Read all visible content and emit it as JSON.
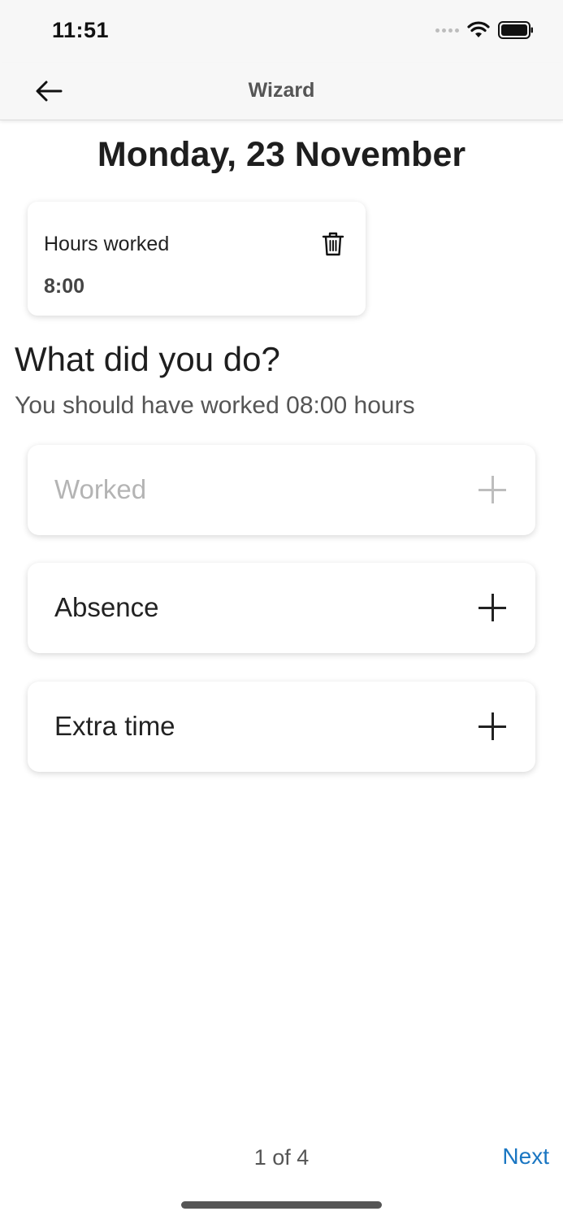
{
  "status_bar": {
    "time": "11:51"
  },
  "nav": {
    "title": "Wizard"
  },
  "date": "Monday, 23 November",
  "hours_card": {
    "label": "Hours worked",
    "value": "8:00"
  },
  "question": "What did you do?",
  "hint": "You should have worked 08:00 hours",
  "options": [
    {
      "label": "Worked",
      "enabled": false
    },
    {
      "label": "Absence",
      "enabled": true
    },
    {
      "label": "Extra time",
      "enabled": true
    }
  ],
  "footer": {
    "pager": "1 of 4",
    "next_label": "Next"
  },
  "colors": {
    "accent": "#1a76c2",
    "disabled": "#b4b4b4",
    "text": "#222222"
  }
}
